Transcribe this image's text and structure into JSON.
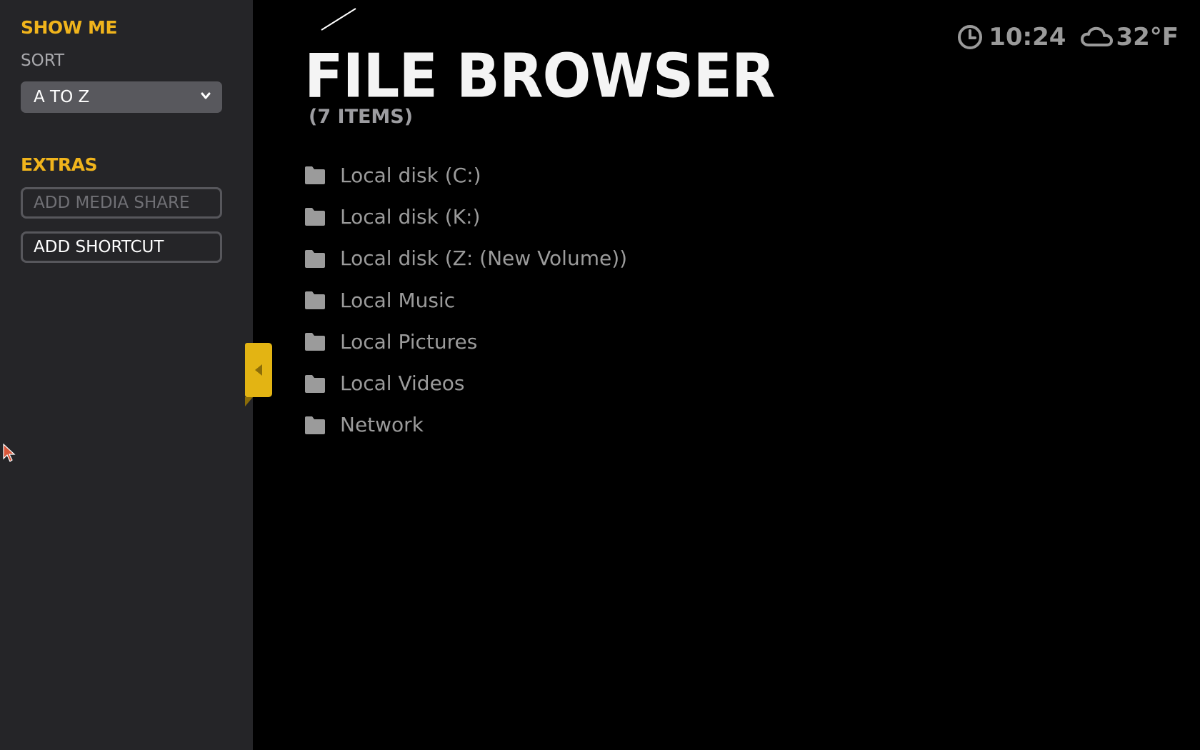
{
  "sidebar": {
    "show_me_title": "SHOW ME",
    "sort_label": "SORT",
    "sort_value": "A TO Z",
    "extras_title": "EXTRAS",
    "add_media_share": "ADD MEDIA SHARE",
    "add_shortcut": "ADD SHORTCUT"
  },
  "header": {
    "title": "FILE BROWSER",
    "item_count": "(7 ITEMS)"
  },
  "status": {
    "time": "10:24",
    "temperature": "32°F"
  },
  "files": [
    {
      "label": "Local disk (C:)"
    },
    {
      "label": "Local disk (K:)"
    },
    {
      "label": "Local disk (Z: (New Volume))"
    },
    {
      "label": "Local Music"
    },
    {
      "label": "Local Pictures"
    },
    {
      "label": "Local Videos"
    },
    {
      "label": "Network"
    }
  ],
  "colors": {
    "accent": "#f0b41c",
    "sidebar_bg": "#252528",
    "main_bg": "#000000",
    "item_text": "#9b9b9b"
  },
  "icons": {
    "sort_dropdown": "chevron-down-icon",
    "collapse": "arrow-left-icon",
    "clock": "clock-icon",
    "weather": "cloud-icon",
    "file_item": "folder-icon"
  }
}
